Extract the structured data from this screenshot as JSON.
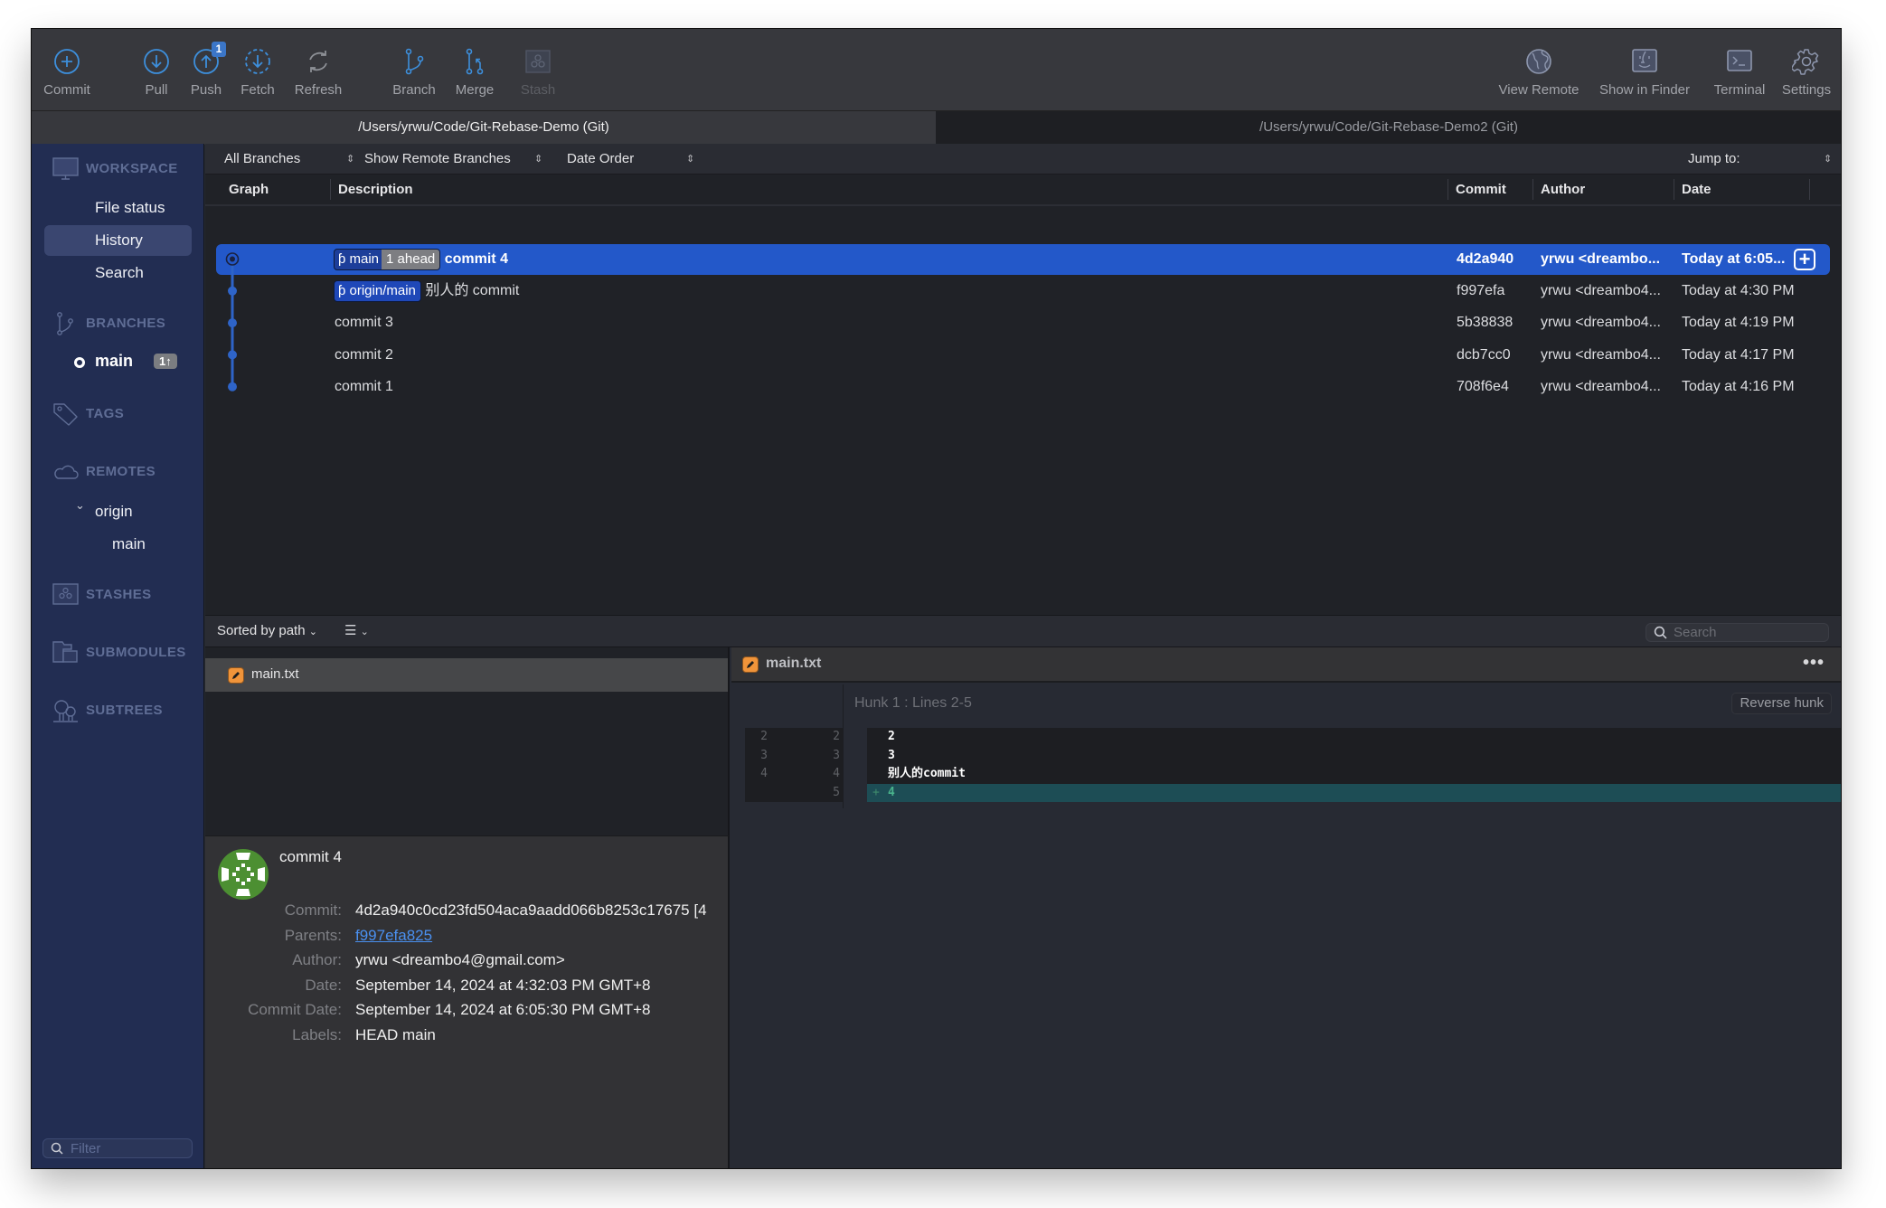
{
  "toolbar": {
    "buttons": [
      {
        "id": "commit",
        "label": "Commit",
        "icon": "plus-circle-icon"
      },
      {
        "id": "pull",
        "label": "Pull",
        "icon": "arrow-down-circle-icon"
      },
      {
        "id": "push",
        "label": "Push",
        "icon": "arrow-up-circle-icon",
        "badge": "1"
      },
      {
        "id": "fetch",
        "label": "Fetch",
        "icon": "dashed-arrow-down-circle-icon"
      },
      {
        "id": "refresh",
        "label": "Refresh",
        "icon": "refresh-icon"
      },
      {
        "id": "branch",
        "label": "Branch",
        "icon": "branch-icon"
      },
      {
        "id": "merge",
        "label": "Merge",
        "icon": "merge-icon"
      },
      {
        "id": "stash",
        "label": "Stash",
        "icon": "stash-icon",
        "disabled": true
      },
      {
        "id": "view_remote",
        "label": "View Remote",
        "icon": "globe-icon"
      },
      {
        "id": "show_in_finder",
        "label": "Show in Finder",
        "icon": "finder-icon"
      },
      {
        "id": "terminal",
        "label": "Terminal",
        "icon": "terminal-icon"
      },
      {
        "id": "settings",
        "label": "Settings",
        "icon": "gear-icon"
      }
    ]
  },
  "tabs": [
    {
      "label": "/Users/yrwu/Code/Git-Rebase-Demo (Git)",
      "active": true
    },
    {
      "label": "/Users/yrwu/Code/Git-Rebase-Demo2 (Git)",
      "active": false
    }
  ],
  "sidebar": {
    "workspace": {
      "title": "WORKSPACE",
      "items": [
        {
          "label": "File status",
          "selected": false
        },
        {
          "label": "History",
          "selected": true
        },
        {
          "label": "Search",
          "selected": false
        }
      ]
    },
    "branches": {
      "title": "BRANCHES",
      "items": [
        {
          "name": "main",
          "badge": "1↑",
          "current": true
        }
      ]
    },
    "tags": {
      "title": "TAGS"
    },
    "remotes": {
      "title": "REMOTES",
      "items": [
        {
          "name": "origin",
          "expanded": true,
          "children": [
            "main"
          ]
        }
      ]
    },
    "stashes": {
      "title": "STASHES"
    },
    "submodules": {
      "title": "SUBMODULES"
    },
    "subtrees": {
      "title": "SUBTREES"
    },
    "filter_placeholder": "Filter"
  },
  "filterbar": {
    "branches_select": "All Branches",
    "remote_select": "Show Remote Branches",
    "order_select": "Date Order",
    "jump_to_label": "Jump to:"
  },
  "columns": {
    "graph": "Graph",
    "description": "Description",
    "commit": "Commit",
    "author": "Author",
    "date": "Date"
  },
  "commits": [
    {
      "refs": [
        {
          "name": "main",
          "ahead": "1 ahead"
        }
      ],
      "message": "commit 4",
      "hash": "4d2a940",
      "author": "yrwu <dreambo...",
      "date": "Today at 6:05...",
      "selected": true,
      "head": true
    },
    {
      "refs": [
        {
          "name": "origin/main"
        }
      ],
      "message": "别人的 commit",
      "hash": "f997efa",
      "author": "yrwu <dreambo4...",
      "date": "Today at 4:30 PM",
      "selected": false
    },
    {
      "refs": [],
      "message": "commit 3",
      "hash": "5b38838",
      "author": "yrwu <dreambo4...",
      "date": "Today at 4:19 PM",
      "selected": false
    },
    {
      "refs": [],
      "message": "commit 2",
      "hash": "dcb7cc0",
      "author": "yrwu <dreambo4...",
      "date": "Today at 4:17 PM",
      "selected": false
    },
    {
      "refs": [],
      "message": "commit 1",
      "hash": "708f6e4",
      "author": "yrwu <dreambo4...",
      "date": "Today at 4:16 PM",
      "selected": false
    }
  ],
  "files_panel": {
    "sort_label": "Sorted by path",
    "search_placeholder": "Search",
    "files": [
      {
        "name": "main.txt",
        "status": "modified"
      }
    ]
  },
  "commit_details": {
    "title": "commit 4",
    "fields": [
      {
        "key": "Commit:",
        "value": "4d2a940c0cd23fd504aca9aadd066b8253c17675 [4",
        "link": false
      },
      {
        "key": "Parents:",
        "value": "f997efa825",
        "link": true
      },
      {
        "key": "Author:",
        "value": "yrwu <dreambo4@gmail.com>",
        "link": false
      },
      {
        "key": "Date:",
        "value": "September 14, 2024 at 4:32:03 PM GMT+8",
        "link": false
      },
      {
        "key": "Commit Date:",
        "value": "September 14, 2024 at 6:05:30 PM GMT+8",
        "link": false
      },
      {
        "key": "Labels:",
        "value": "HEAD main",
        "link": false
      }
    ]
  },
  "diff": {
    "file": "main.txt",
    "hunk_title": "Hunk 1 : Lines 2-5",
    "reverse_label": "Reverse hunk",
    "lines": [
      {
        "old": "2",
        "new": "2",
        "marker": "",
        "text": "2",
        "type": "context"
      },
      {
        "old": "3",
        "new": "3",
        "marker": "",
        "text": "3",
        "type": "context"
      },
      {
        "old": "4",
        "new": "4",
        "marker": "",
        "text": "别人的commit",
        "type": "context"
      },
      {
        "old": "",
        "new": "5",
        "marker": "+",
        "text": "4",
        "type": "added"
      }
    ]
  },
  "colors": {
    "accent": "#2358c9",
    "sidebar_bg": "#222d52",
    "graph_line": "#2e64c8",
    "added_bg": "#1d4d55",
    "modified_icon": "#f0943a",
    "link": "#4a90f0"
  }
}
